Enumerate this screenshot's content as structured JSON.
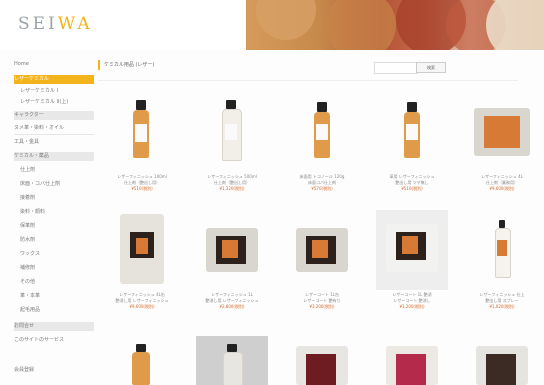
{
  "header": {
    "logo_text_a": "SEI",
    "logo_text_b": "WA"
  },
  "sidebar": {
    "items": [
      {
        "label": "Home"
      },
      {
        "label": "レザーケミカル"
      },
      {
        "label": "レザーケミカル I"
      },
      {
        "label": "レザーケミカル II(上)"
      },
      {
        "label": "キャラクター"
      },
      {
        "label": "ヌメ革・染料・オイル"
      },
      {
        "label": "工具・金具"
      },
      {
        "label": "ケミカル・薬品"
      },
      {
        "label": "仕上剤"
      },
      {
        "label": "床面・コバ仕上剤"
      },
      {
        "label": "接着剤"
      },
      {
        "label": "染料・顔料"
      },
      {
        "label": "保革剤"
      },
      {
        "label": "防水剤"
      },
      {
        "label": "ワックス"
      },
      {
        "label": "補修剤"
      },
      {
        "label": "その他"
      },
      {
        "label": "革・本革"
      },
      {
        "label": "起毛用品"
      },
      {
        "label": "お問合せ"
      },
      {
        "label": "このサイトのサービス"
      },
      {
        "label": "会員登録"
      }
    ]
  },
  "main": {
    "title": "ケミカル用品 (レザー)",
    "search_placeholder": "",
    "search_button": "検索"
  },
  "products": [
    {
      "name": "レザーフィニッシュ 100ml",
      "sub": "仕上剤（艶出し用）",
      "price": "¥510(税別)"
    },
    {
      "name": "レザーフィニッシュ 500ml",
      "sub": "仕上剤（艶出し用）",
      "price": "¥1,320(税別)"
    },
    {
      "name": "床面用 トコノール 120g",
      "sub": "床面コバ仕上剤",
      "price": "¥570(税別)"
    },
    {
      "name": "革用 レザーフィニッシュ",
      "sub": "艶出し用 ツヤ無し",
      "price": "¥510(税別)"
    },
    {
      "name": "レザーフィニッシュ 4L",
      "sub": "仕上剤（業務用）",
      "price": "¥9,600(税別)"
    },
    {
      "name": "レザーフィニッシュ 4L缶",
      "sub": "艶消し用 レザーフィニッシュ",
      "price": "¥9,600(税別)"
    },
    {
      "name": "レザーフィニッシュ 1L",
      "sub": "艶消し用 レザーフィニッシュ",
      "price": "¥2,800(税別)"
    },
    {
      "name": "レザーコート 1L缶",
      "sub": "レザーコート 艶有り",
      "price": "¥3,200(税別)"
    },
    {
      "name": "レザーコート 1L 艶消",
      "sub": "レザーコート 艶消し",
      "price": "¥3,200(税別)"
    },
    {
      "name": "レザーフィニッシュ 仕上",
      "sub": "艶出し用 スプレー",
      "price": "¥1,020(税別)"
    }
  ]
}
